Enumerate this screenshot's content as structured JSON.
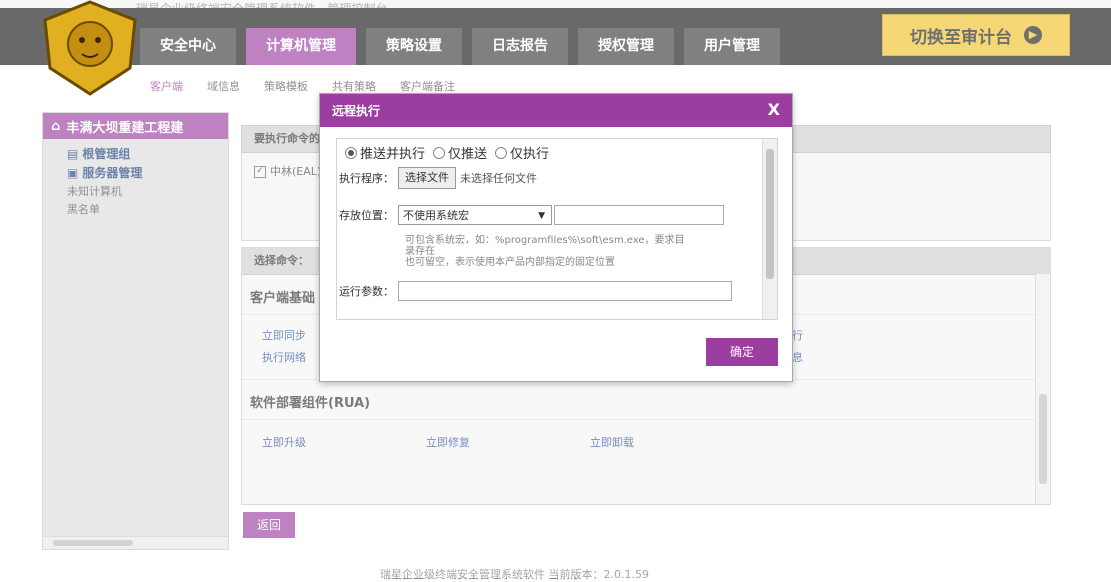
{
  "header": {
    "title_faded": "瑞星企业级终端安全管理系统软件 · 管理控制台",
    "tabs": [
      {
        "label": "安全中心",
        "active": false
      },
      {
        "label": "计算机管理",
        "active": true
      },
      {
        "label": "策略设置",
        "active": false
      },
      {
        "label": "日志报告",
        "active": false
      },
      {
        "label": "授权管理",
        "active": false
      },
      {
        "label": "用户管理",
        "active": false
      }
    ],
    "switch_label": "切换至审计台",
    "switch_icon": "arrow-right-circle-icon"
  },
  "subnav": [
    "客户端",
    "域信息",
    "策略模板",
    "共有策略",
    "客户端备注"
  ],
  "sidebar": {
    "root": "丰满大坝重建工程建",
    "items": [
      {
        "label": "根管理组",
        "bold": true
      },
      {
        "label": "服务器管理",
        "bold": true
      },
      {
        "label": "未知计算机",
        "bold": false
      },
      {
        "label": "黑名单",
        "bold": false
      }
    ]
  },
  "main": {
    "exec_target_header": "要执行命令的",
    "exec_target_item": "中林(EAL)",
    "select_cmd_header": "选择命令：",
    "group1_title": "客户端基础",
    "group1_links": [
      "立即同步",
      "执行网络"
    ],
    "group2_title": "软件部署组件(RUA)",
    "group2_links": [
      "立即升级",
      "立即修复",
      "立即卸载"
    ],
    "right_fragments": [
      "行",
      "息"
    ],
    "back_label": "返回"
  },
  "footer": "瑞星企业级终端安全管理系统软件 当前版本：2.0.1.59",
  "modal": {
    "title": "远程执行",
    "close": "X",
    "radios": [
      {
        "label": "推送并执行",
        "checked": true
      },
      {
        "label": "仅推送",
        "checked": false
      },
      {
        "label": "仅执行",
        "checked": false
      }
    ],
    "program_label": "执行程序：",
    "file_button": "选择文件",
    "no_file": "未选择任何文件",
    "location_label": "存放位置：",
    "location_value": "不使用系统宏",
    "hint_line1": "可包含系统宏，如：%programfiles%\\soft\\esm.exe，要求目",
    "hint_line2": "录存在",
    "hint_line3": "也可留空，表示使用本产品内部指定的固定位置",
    "params_label": "运行参数：",
    "confirm": "确定"
  },
  "colors": {
    "accent": "#9b3ea0",
    "gold": "#f0c42b",
    "nav_bg": "#3c3c3c"
  }
}
